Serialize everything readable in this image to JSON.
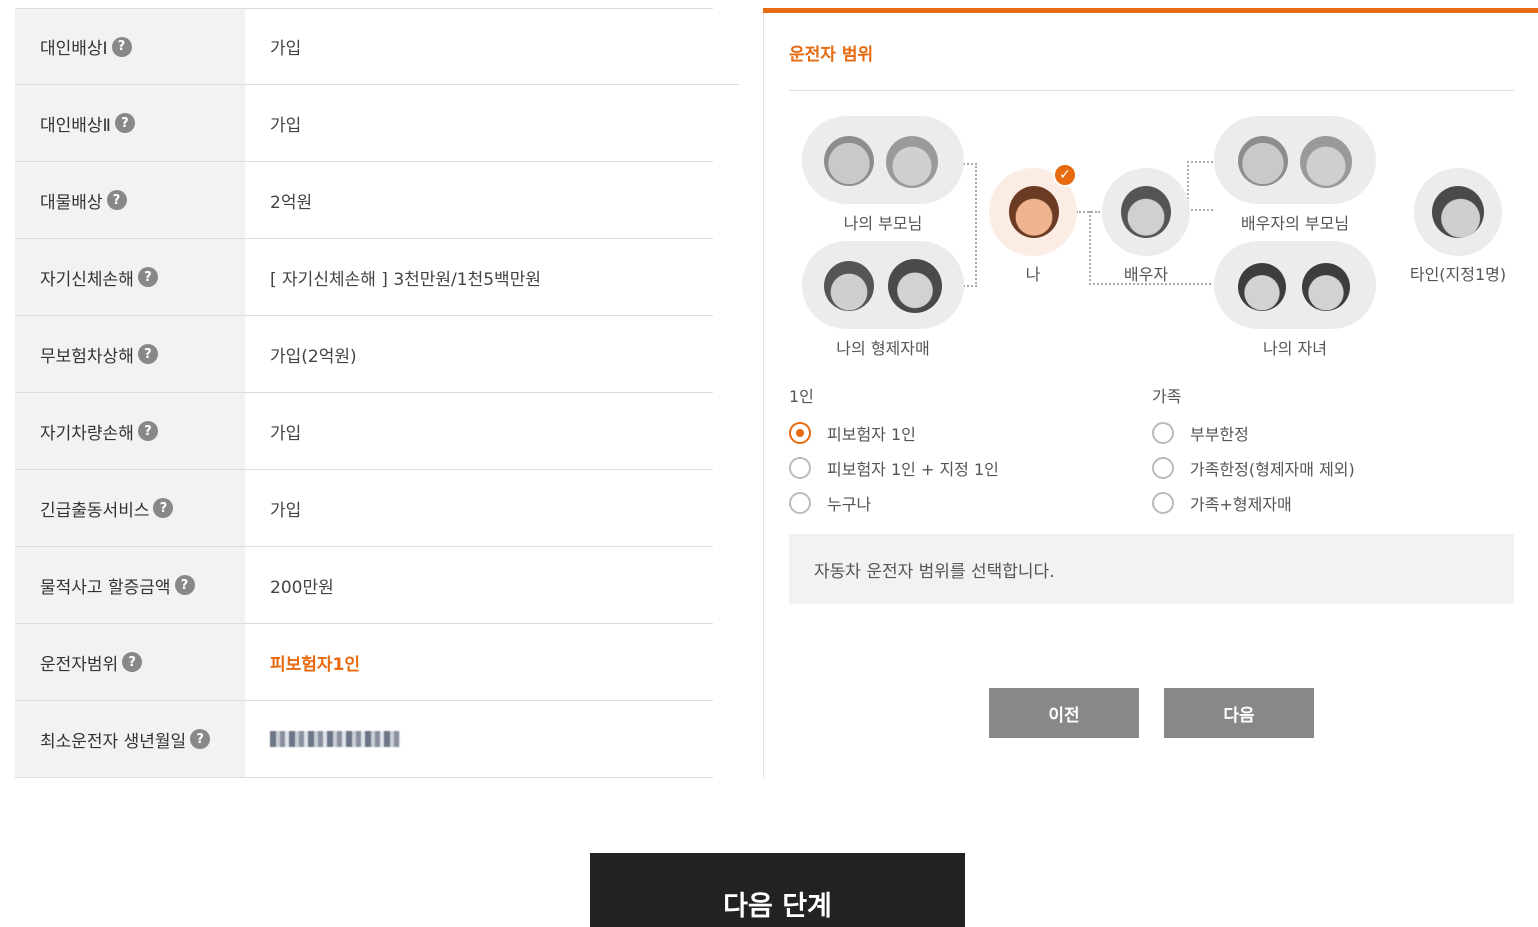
{
  "table": {
    "rows": [
      {
        "label": "대인배상Ⅰ",
        "value": "가입"
      },
      {
        "label": "대인배상Ⅱ",
        "value": "가입"
      },
      {
        "label": "대물배상",
        "value": "2억원"
      },
      {
        "label": "자기신체손해",
        "value": "[ 자기신체손해 ]  3천만원/1천5백만원"
      },
      {
        "label": "무보험차상해",
        "value": "가입(2억원)"
      },
      {
        "label": "자기차량손해",
        "value": "가입"
      },
      {
        "label": "긴급출동서비스",
        "value": "가입"
      },
      {
        "label": "물적사고 할증금액",
        "value": "200만원"
      },
      {
        "label": "운전자범위",
        "value": "피보험자1인"
      },
      {
        "label": "최소운전자 생년월일",
        "value": ""
      }
    ],
    "help_icon": "?"
  },
  "panel": {
    "title": "운전자 범위",
    "figures": {
      "my_parents": "나의 부모님",
      "my_siblings": "나의 형제자매",
      "me": "나",
      "spouse": "배우자",
      "spouse_parents": "배우자의 부모님",
      "my_children": "나의 자녀",
      "other": "타인(지정1명)"
    },
    "check_icon": "✓",
    "groups": {
      "single": {
        "header": "1인",
        "options": [
          "피보험자 1인",
          "피보험자 1인 + 지정 1인",
          "누구나"
        ],
        "selected": 0
      },
      "family": {
        "header": "가족",
        "options": [
          "부부한정",
          "가족한정(형제자매 제외)",
          "가족+형제자매"
        ]
      }
    },
    "description": "자동차 운전자 범위를 선택합니다.",
    "prev_label": "이전",
    "next_label": "다음"
  },
  "next_step_label": "다음 단계",
  "colors": {
    "accent": "#e86a10",
    "button_gray": "#888888",
    "dark": "#222222"
  }
}
